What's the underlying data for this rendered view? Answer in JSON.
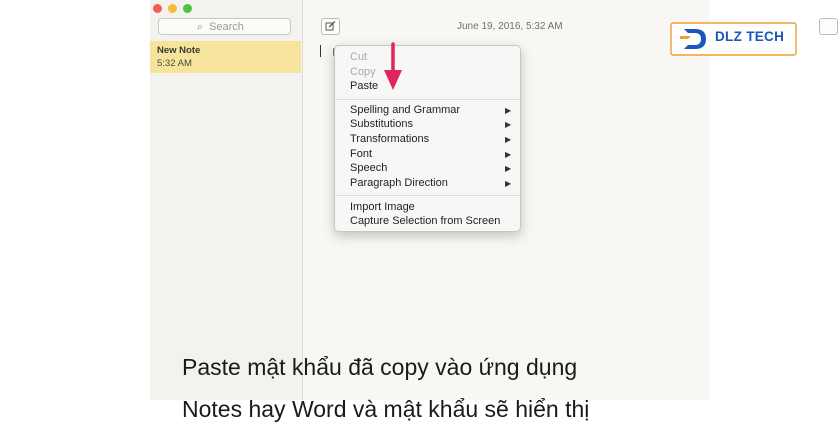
{
  "window": {
    "traffic_lights": {
      "close": "#ee5f56",
      "minimize": "#f5bc33",
      "zoom": "#4fc444"
    }
  },
  "sidebar": {
    "search": {
      "icon": "search-icon",
      "placeholder": "Search"
    },
    "notes": [
      {
        "title": "New Note",
        "time": "5:32 AM",
        "color": "#f6e49c"
      }
    ]
  },
  "editor": {
    "date": "June 19, 2016, 5:32 AM"
  },
  "context_menu": {
    "group1": [
      {
        "label": "Cut",
        "enabled": false
      },
      {
        "label": "Copy",
        "enabled": false
      },
      {
        "label": "Paste",
        "enabled": true
      }
    ],
    "group2": [
      {
        "label": "Spelling and Grammar",
        "submenu": true
      },
      {
        "label": "Substitutions",
        "submenu": true
      },
      {
        "label": "Transformations",
        "submenu": true
      },
      {
        "label": "Font",
        "submenu": true
      },
      {
        "label": "Speech",
        "submenu": true
      },
      {
        "label": "Paragraph Direction",
        "submenu": true
      }
    ],
    "group3": [
      {
        "label": "Import Image"
      },
      {
        "label": "Capture Selection from Screen"
      }
    ],
    "submenu_icon": "triangle-right-icon"
  },
  "annotation": {
    "arrow_color": "#e0245e"
  },
  "brand": {
    "name": "DLZ TECH",
    "color": "#1b57b8"
  },
  "caption": {
    "line1": "Paste mật khẩu đã copy vào ứng dụng",
    "line2": "Notes hay Word và mật khẩu sẽ hiển thị"
  }
}
